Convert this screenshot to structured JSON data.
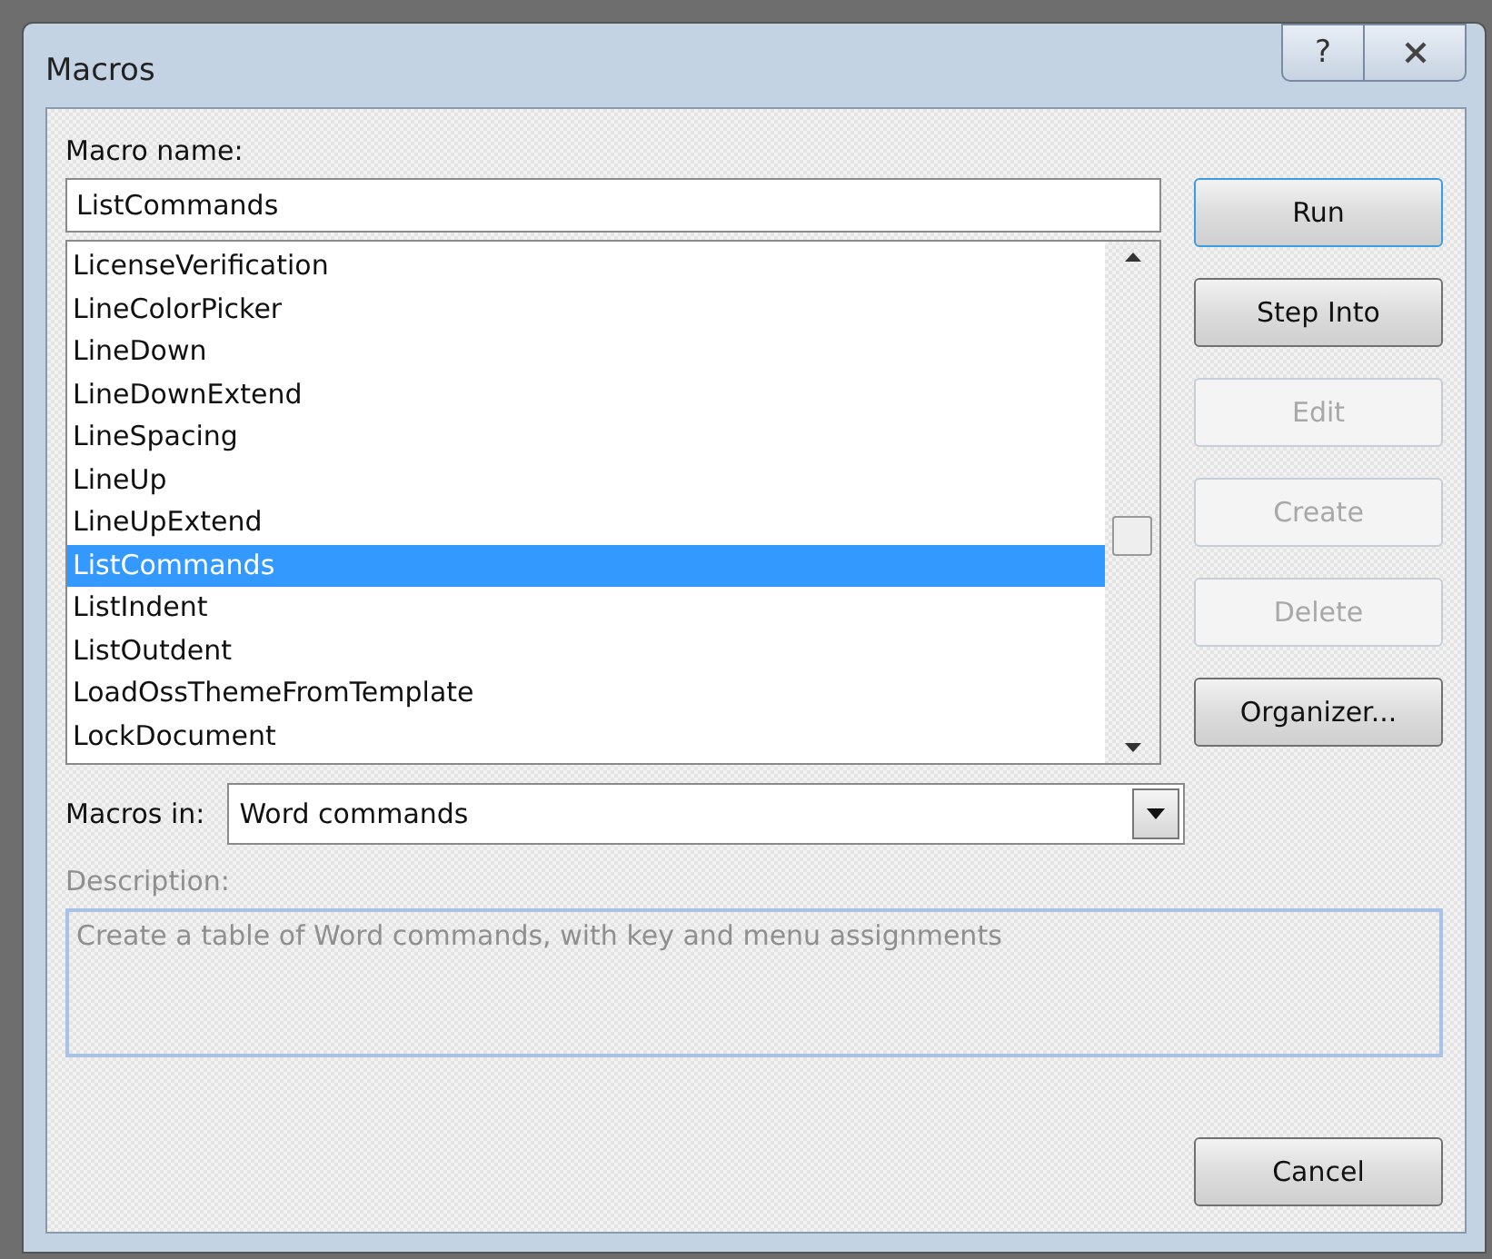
{
  "window": {
    "title": "Macros",
    "help_button": "?"
  },
  "macro_name": {
    "label": "Macro name:",
    "value": "ListCommands"
  },
  "macros": [
    {
      "name": "LicenseVerification",
      "selected": false
    },
    {
      "name": "LineColorPicker",
      "selected": false
    },
    {
      "name": "LineDown",
      "selected": false
    },
    {
      "name": "LineDownExtend",
      "selected": false
    },
    {
      "name": "LineSpacing",
      "selected": false
    },
    {
      "name": "LineUp",
      "selected": false
    },
    {
      "name": "LineUpExtend",
      "selected": false
    },
    {
      "name": "ListCommands",
      "selected": true
    },
    {
      "name": "ListIndent",
      "selected": false
    },
    {
      "name": "ListOutdent",
      "selected": false
    },
    {
      "name": "LoadOssThemeFromTemplate",
      "selected": false
    },
    {
      "name": "LockDocument",
      "selected": false
    }
  ],
  "buttons": [
    {
      "label": "Run",
      "disabled": false,
      "default": true
    },
    {
      "label": "Step Into",
      "disabled": false,
      "default": false
    },
    {
      "label": "Edit",
      "disabled": true,
      "default": false
    },
    {
      "label": "Create",
      "disabled": true,
      "default": false
    },
    {
      "label": "Delete",
      "disabled": true,
      "default": false
    },
    {
      "label": "Organizer...",
      "disabled": false,
      "default": false
    }
  ],
  "macros_in": {
    "label": "Macros in:",
    "value": "Word commands"
  },
  "description": {
    "label": "Description:",
    "value": "Create a table of Word commands, with key and menu assignments",
    "disabled": true
  },
  "cancel_button": "Cancel"
}
